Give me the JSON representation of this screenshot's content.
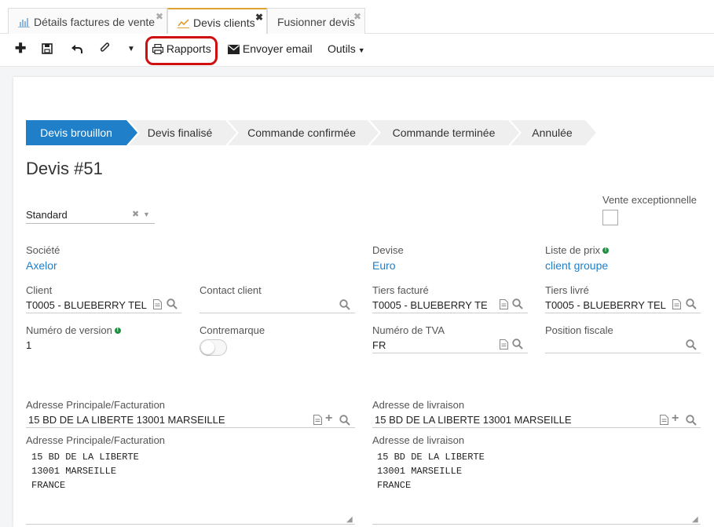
{
  "tabs": [
    {
      "label": "Détails factures de vente"
    },
    {
      "label": "Devis clients"
    },
    {
      "label": "Fusionner devis"
    }
  ],
  "toolbar": {
    "reports_label": "Rapports",
    "email_label": "Envoyer email",
    "tools_label": "Outils"
  },
  "steps": [
    "Devis brouillon",
    "Devis finalisé",
    "Commande confirmée",
    "Commande terminée",
    "Annulée"
  ],
  "title": "Devis #51",
  "form": {
    "type_value": "Standard",
    "exceptional_label": "Vente exceptionnelle",
    "company_label": "Société",
    "company_value": "Axelor",
    "currency_label": "Devise",
    "currency_value": "Euro",
    "pricelist_label": "Liste de prix",
    "pricelist_value": "client groupe",
    "client_label": "Client",
    "client_value": "T0005 - BLUEBERRY TEL",
    "contact_label": "Contact client",
    "invoiced_label": "Tiers facturé",
    "invoiced_value": "T0005 - BLUEBERRY TEL",
    "delivered_label": "Tiers livré",
    "delivered_value": "T0005 - BLUEBERRY TEL",
    "version_label": "Numéro de version",
    "version_value": "1",
    "contremarque_label": "Contremarque",
    "vat_label": "Numéro de TVA",
    "vat_value": "FR",
    "fiscal_label": "Position fiscale",
    "main_addr_label": "Adresse Principale/Facturation",
    "main_addr_value": "15 BD DE LA LIBERTE 13001 MARSEILLE",
    "delivery_addr_label": "Adresse de livraison",
    "delivery_addr_value": "15 BD DE LA LIBERTE 13001 MARSEILLE",
    "main_addr_text_label": "Adresse Principale/Facturation",
    "main_addr_text": "15 BD DE LA LIBERTE\n13001 MARSEILLE\nFRANCE",
    "delivery_addr_text_label": "Adresse de livraison",
    "delivery_addr_text": "15 BD DE LA LIBERTE\n13001 MARSEILLE\nFRANCE"
  },
  "colors": {
    "accent": "#1f7fc9",
    "step_active": "#1f7fc9",
    "highlight": "#d01010"
  }
}
